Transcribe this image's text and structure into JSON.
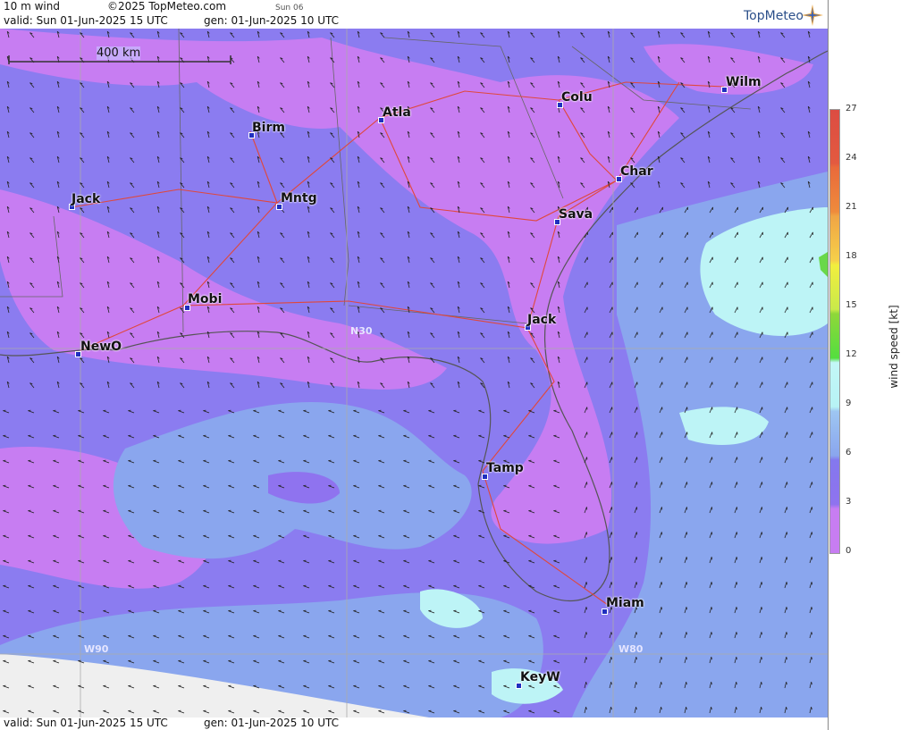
{
  "header": {
    "field": "10 m wind",
    "copyright": "©2025 TopMeteo.com",
    "day": "Sun 06",
    "valid": "valid:  Sun  01-Jun-2025  15 UTC",
    "gen": "gen: 01-Jun-2025 10 UTC",
    "brand": "TopMeteo"
  },
  "footer": {
    "valid": "valid:  Sun  01-Jun-2025  15 UTC",
    "gen": "gen: 01-Jun-2025 10 UTC"
  },
  "map": {
    "scale_label": "400 km",
    "grid_labels": [
      "N30",
      "W90",
      "W80"
    ],
    "cities": [
      {
        "name": "Wilm"
      },
      {
        "name": "Colu"
      },
      {
        "name": "Atla"
      },
      {
        "name": "Birm"
      },
      {
        "name": "Char"
      },
      {
        "name": "Sava"
      },
      {
        "name": "Jack"
      },
      {
        "name": "Mntg"
      },
      {
        "name": "Mobi"
      },
      {
        "name": "Jack"
      },
      {
        "name": "NewO"
      },
      {
        "name": "Tamp"
      },
      {
        "name": "Miam"
      },
      {
        "name": "KeyW"
      }
    ]
  },
  "legend": {
    "title": "wind speed [kt]",
    "ticks": [
      "27",
      "24",
      "21",
      "18",
      "15",
      "12",
      "9",
      "6",
      "3",
      "0"
    ]
  },
  "colors": {
    "calm": "#c77df2",
    "light": "#8f73ef",
    "moderate": "#8aa6ee",
    "fresh": "#b7f3f5",
    "roads": "#e0473b",
    "borders": "#555555",
    "city_marker": "#1f2fbf"
  }
}
